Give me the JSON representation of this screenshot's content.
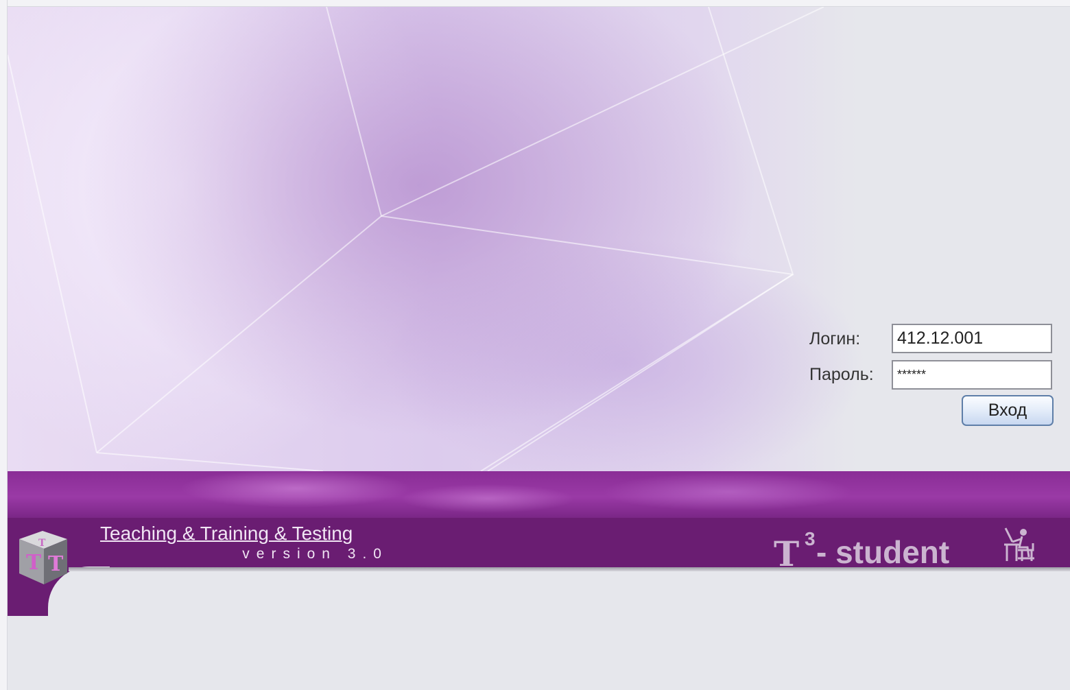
{
  "login_form": {
    "login_label": "Логин:",
    "login_value": "412.12.001",
    "password_label": "Пароль:",
    "password_value": "******",
    "submit_label": "Вход"
  },
  "banner": {
    "tagline": "Teaching & Training & Testing",
    "version": "version 3.0",
    "product_prefix": "T",
    "product_sup": "3",
    "product_name": "- student",
    "logo_letters": "TT"
  },
  "colors": {
    "banner_bar": "#6a1d72",
    "banner_top": "#9a3aa6",
    "background": "#e6e7ec",
    "button_border": "#5e7ea8"
  },
  "icons": [
    "cube-logo-icon",
    "student-at-desk-icon"
  ]
}
